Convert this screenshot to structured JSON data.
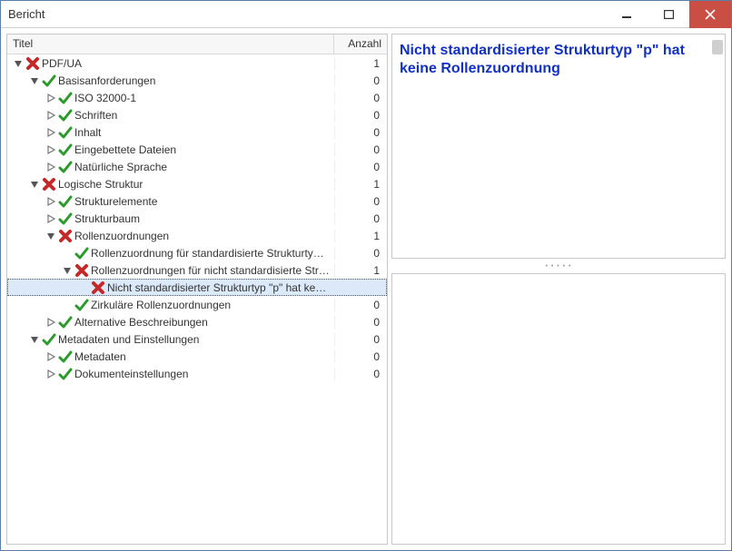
{
  "window": {
    "title": "Bericht"
  },
  "tree": {
    "header": {
      "title": "Titel",
      "count": "Anzahl"
    },
    "rows": [
      {
        "depth": 0,
        "tw": "open",
        "icon": "error",
        "label": "PDF/UA",
        "count": "1"
      },
      {
        "depth": 1,
        "tw": "open",
        "icon": "pass",
        "label": "Basisanforderungen",
        "count": "0"
      },
      {
        "depth": 2,
        "tw": "closed",
        "icon": "pass",
        "label": "ISO 32000-1",
        "count": "0"
      },
      {
        "depth": 2,
        "tw": "closed",
        "icon": "pass",
        "label": "Schriften",
        "count": "0"
      },
      {
        "depth": 2,
        "tw": "closed",
        "icon": "pass",
        "label": "Inhalt",
        "count": "0"
      },
      {
        "depth": 2,
        "tw": "closed",
        "icon": "pass",
        "label": "Eingebettete Dateien",
        "count": "0"
      },
      {
        "depth": 2,
        "tw": "closed",
        "icon": "pass",
        "label": "Natürliche Sprache",
        "count": "0"
      },
      {
        "depth": 1,
        "tw": "open",
        "icon": "error",
        "label": "Logische Struktur",
        "count": "1"
      },
      {
        "depth": 2,
        "tw": "closed",
        "icon": "pass",
        "label": "Strukturelemente",
        "count": "0"
      },
      {
        "depth": 2,
        "tw": "closed",
        "icon": "pass",
        "label": "Strukturbaum",
        "count": "0"
      },
      {
        "depth": 2,
        "tw": "open",
        "icon": "error",
        "label": "Rollenzuordnungen",
        "count": "1"
      },
      {
        "depth": 3,
        "tw": "none",
        "icon": "pass",
        "label": "Rollenzuordnung für standardisierte Strukturty…",
        "count": "0"
      },
      {
        "depth": 3,
        "tw": "open",
        "icon": "error",
        "label": "Rollenzuordnungen für nicht standardisierte Str…",
        "count": "1"
      },
      {
        "depth": 4,
        "tw": "none",
        "icon": "error",
        "label": "Nicht standardisierter Strukturtyp \"p\" hat ke…",
        "count": "",
        "selected": true,
        "nav": true
      },
      {
        "depth": 3,
        "tw": "none",
        "icon": "pass",
        "label": "Zirkuläre Rollenzuordnungen",
        "count": "0"
      },
      {
        "depth": 2,
        "tw": "closed",
        "icon": "pass",
        "label": "Alternative Beschreibungen",
        "count": "0"
      },
      {
        "depth": 1,
        "tw": "open",
        "icon": "pass",
        "label": "Metadaten und Einstellungen",
        "count": "0"
      },
      {
        "depth": 2,
        "tw": "closed",
        "icon": "pass",
        "label": "Metadaten",
        "count": "0"
      },
      {
        "depth": 2,
        "tw": "closed",
        "icon": "pass",
        "label": "Dokumenteinstellungen",
        "count": "0"
      }
    ]
  },
  "detail": {
    "heading": "Nicht standardisierter Strukturtyp \"p\" hat keine Rollenzuordnung"
  },
  "splitter": "• • • • •"
}
